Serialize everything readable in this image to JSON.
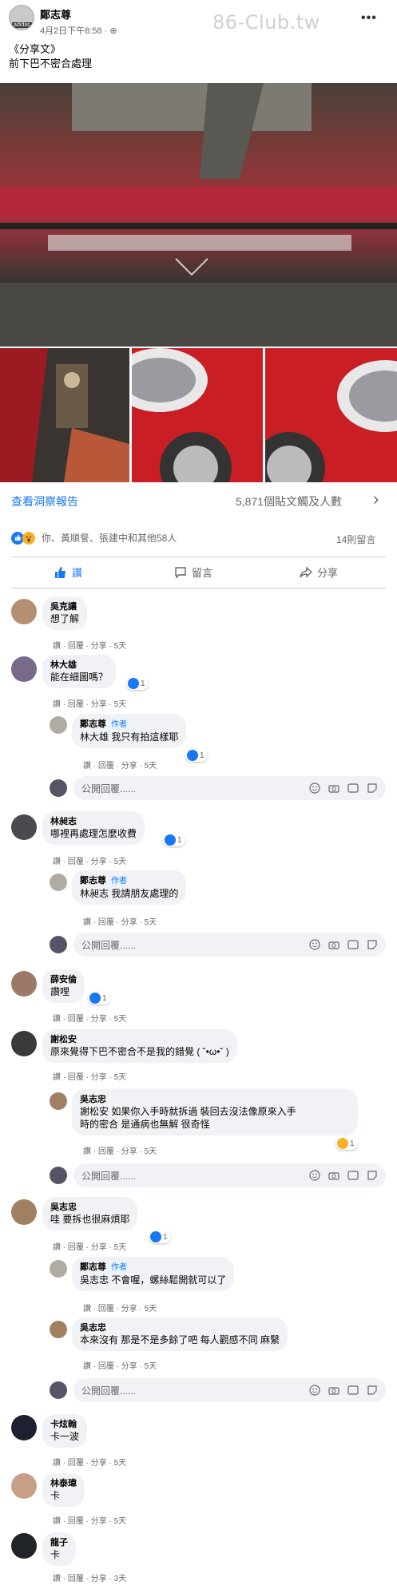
{
  "post": {
    "author": "鄭志尊",
    "date": "4月2日下午8:58 · ",
    "globe": "⊕",
    "avatar_text": "adidas",
    "watermark": "86-Club.tw",
    "more": "•••",
    "line1": "《分享文》",
    "line2": "前下巴不密合處理"
  },
  "insights": {
    "link": "查看洞察報告",
    "reach": "5,871個貼文觸及人數",
    "chevron": "›"
  },
  "reactions": {
    "text": "你、黃順詧、張建中和其他58人",
    "comments": "14則留言"
  },
  "actions": {
    "like": "讚",
    "comment": "留言",
    "share": "分享"
  },
  "reply_placeholder": "公開回覆......",
  "meta_5": "讚 · 回覆 · 分享 · 5天",
  "meta_3": "讚 · 回覆 · 分享 · 3天",
  "author_tag": "作者",
  "comments": [
    {
      "name": "吳克讓",
      "text": "想了解"
    },
    {
      "name": "林大雄",
      "text": "能在細圖嗎？",
      "likes": "1"
    },
    {
      "name": "鄭志尊",
      "text": "林大雄 我只有拍這樣耶",
      "likes": "1"
    },
    {
      "name": "林昶志",
      "text": "哪裡再處理怎麼收費",
      "likes": "1"
    },
    {
      "name": "鄭志尊",
      "text": "林昶志 我請朋友處理的"
    },
    {
      "name": "薛安倫",
      "text": "讚哩",
      "likes": "1"
    },
    {
      "name": "謝松安",
      "text": "原來覺得下巴不密合不是我的錯覺 ( ˘•ω•˘ )"
    },
    {
      "name": "吳志忠",
      "text1": "謝松安 如果你入手時就拆過 裝回去沒法像原來入手",
      "text2": "時的密合 是通病也無解 很奇怪",
      "likes": "1"
    },
    {
      "name": "吳志忠",
      "text": "哇 要拆也很麻煩耶",
      "likes": "1"
    },
    {
      "name": "鄭志尊",
      "text": "吳志忠 不會喔，螺絲鬆開就可以了"
    },
    {
      "name": "吳志忠",
      "text": "本來沒有 那是不是多餘了吧 每人觀感不同 麻繄"
    },
    {
      "name": "卡炫翰",
      "text": "卡一波"
    },
    {
      "name": "林泰瑋",
      "text": "卡"
    },
    {
      "name": "龍子",
      "text": "卡"
    }
  ],
  "colors": {
    "accent": "#1877f2",
    "bubble": "#f0f2f5",
    "muted": "#65676b",
    "wow": "#f7b125"
  }
}
